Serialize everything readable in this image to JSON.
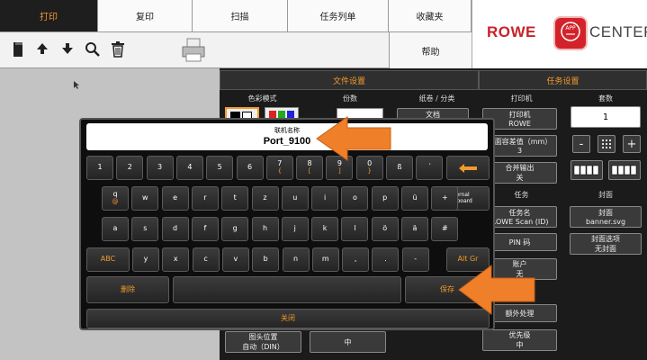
{
  "tabs": [
    "打印",
    "复印",
    "扫描",
    "任务列单",
    "收藏夹"
  ],
  "active_tab": "打印",
  "logo": {
    "left": "ROWE",
    "app": "APP",
    "right": "CENTER",
    "brand_color": "#c7232a"
  },
  "help_label": "帮助",
  "toolbar_icons": [
    "folder-icon",
    "arrow-up-icon",
    "arrow-down-icon",
    "search-icon",
    "trash-icon",
    "printer-icon"
  ],
  "panel": {
    "file_settings": "文件设置",
    "job_settings": "任务设置",
    "color_mode": "色彩模式",
    "copies": "份数",
    "fold_sort": "纸卷 / 分类",
    "printer": "打印机",
    "printer_btn": [
      "打印机",
      "ROWE"
    ],
    "page_length_btn": [
      "页面容差值（mm）",
      "3"
    ],
    "merge_btn": [
      "合并输出",
      "关"
    ],
    "sets": "套数",
    "sets_value": "1",
    "task": "任务",
    "task_name_btn": [
      "任务名",
      "ROWE Scan (ID)"
    ],
    "pin_btn": "PIN 码",
    "account_btn": [
      "账户",
      "无"
    ],
    "cover": "封面",
    "cover_btn": [
      "封面",
      "banner.svg"
    ],
    "cover_option_btn": [
      "封面选项",
      "无封面"
    ],
    "post_processing": "额外处理",
    "priority_btn": [
      "优先级",
      "中"
    ],
    "position_btn": [
      "图头位置",
      "自动（DIN）"
    ],
    "mid_btn": "中",
    "fold_btn": "文档"
  },
  "keyboard": {
    "input_label": "联机名称",
    "input_value": "Port_9100",
    "row1": [
      {
        "k": "1",
        "s": ""
      },
      {
        "k": "2",
        "s": ""
      },
      {
        "k": "3",
        "s": ""
      },
      {
        "k": "4",
        "s": ""
      },
      {
        "k": "5",
        "s": ""
      },
      {
        "k": "6",
        "s": ""
      },
      {
        "k": "7",
        "s": "{"
      },
      {
        "k": "8",
        "s": "["
      },
      {
        "k": "9",
        "s": "]"
      },
      {
        "k": "0",
        "s": "}"
      },
      {
        "k": "ß",
        "s": ""
      },
      {
        "k": "´",
        "s": ""
      }
    ],
    "row2": [
      {
        "k": "q",
        "s": "@"
      },
      {
        "k": "w",
        "s": ""
      },
      {
        "k": "e",
        "s": ""
      },
      {
        "k": "r",
        "s": ""
      },
      {
        "k": "t",
        "s": ""
      },
      {
        "k": "z",
        "s": ""
      },
      {
        "k": "u",
        "s": ""
      },
      {
        "k": "i",
        "s": ""
      },
      {
        "k": "o",
        "s": ""
      },
      {
        "k": "p",
        "s": ""
      },
      {
        "k": "ü",
        "s": ""
      },
      {
        "k": "+",
        "s": ""
      }
    ],
    "external": "external keyboard",
    "row3": [
      "a",
      "s",
      "d",
      "f",
      "g",
      "h",
      "j",
      "k",
      "l",
      "ö",
      "ä",
      "#"
    ],
    "row4": [
      "y",
      "x",
      "c",
      "v",
      "b",
      "n",
      "m",
      ",",
      ".",
      "-"
    ],
    "abc": "ABC",
    "altgr": "Alt Gr",
    "delete": "删除",
    "save": "保存",
    "close": "关闭"
  }
}
